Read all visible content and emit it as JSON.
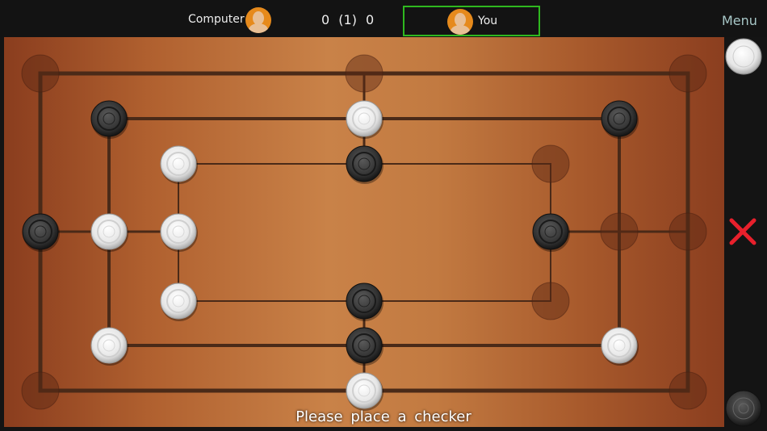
{
  "header": {
    "computer_label": "Computer",
    "score": "0 (1) 0",
    "you_label": "You",
    "menu_label": "Menu",
    "active_player": "You"
  },
  "status": "Please place a checker",
  "side": {
    "player_piece": "white",
    "remove_icon": "red-x-icon",
    "computer_piece": "black"
  },
  "colors": {
    "active_border": "#2fb81f",
    "avatar": "#e68a1c",
    "remove": "#e8202c"
  },
  "board": {
    "rings": [
      "outer",
      "middle",
      "inner"
    ],
    "points": {
      "outer": [
        "empty",
        "empty",
        "empty",
        "empty",
        "empty",
        "white",
        "empty",
        "black"
      ],
      "middle": [
        "black",
        "white",
        "black",
        "empty",
        "white",
        "black",
        "white",
        "white"
      ],
      "inner": [
        "white",
        "black",
        "empty",
        "black",
        "empty",
        "black",
        "white",
        "white"
      ]
    }
  }
}
